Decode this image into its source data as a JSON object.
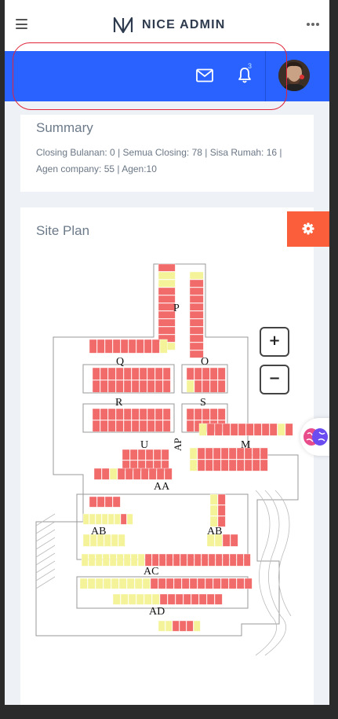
{
  "header": {
    "brand": "NICE ADMIN",
    "notification_count": "3"
  },
  "icons": [
    "menu-icon",
    "brand-logo-icon",
    "more-icon",
    "mail-icon",
    "bell-icon",
    "avatar",
    "gear-icon",
    "brain-icon"
  ],
  "colors": {
    "primary": "#2962ff",
    "accent": "#fb5e3a",
    "annotation": "#e0253a",
    "plot_red": "#f26b6b",
    "plot_yellow": "#f4f39a",
    "plot_green": "#2e9e3e"
  },
  "summary": {
    "title": "Summary",
    "text": "Closing Bulanan: 0 | Semua Closing: 78 | Sisa Rumah: 16 | Agen company: 55 | Agen:10"
  },
  "siteplan": {
    "title": "Site Plan",
    "zoom_in": "+",
    "zoom_out": "−",
    "block_labels": [
      "P",
      "Q",
      "O",
      "R",
      "S",
      "U",
      "AP",
      "M",
      "AA",
      "AB",
      "AB",
      "AC",
      "AD"
    ]
  }
}
